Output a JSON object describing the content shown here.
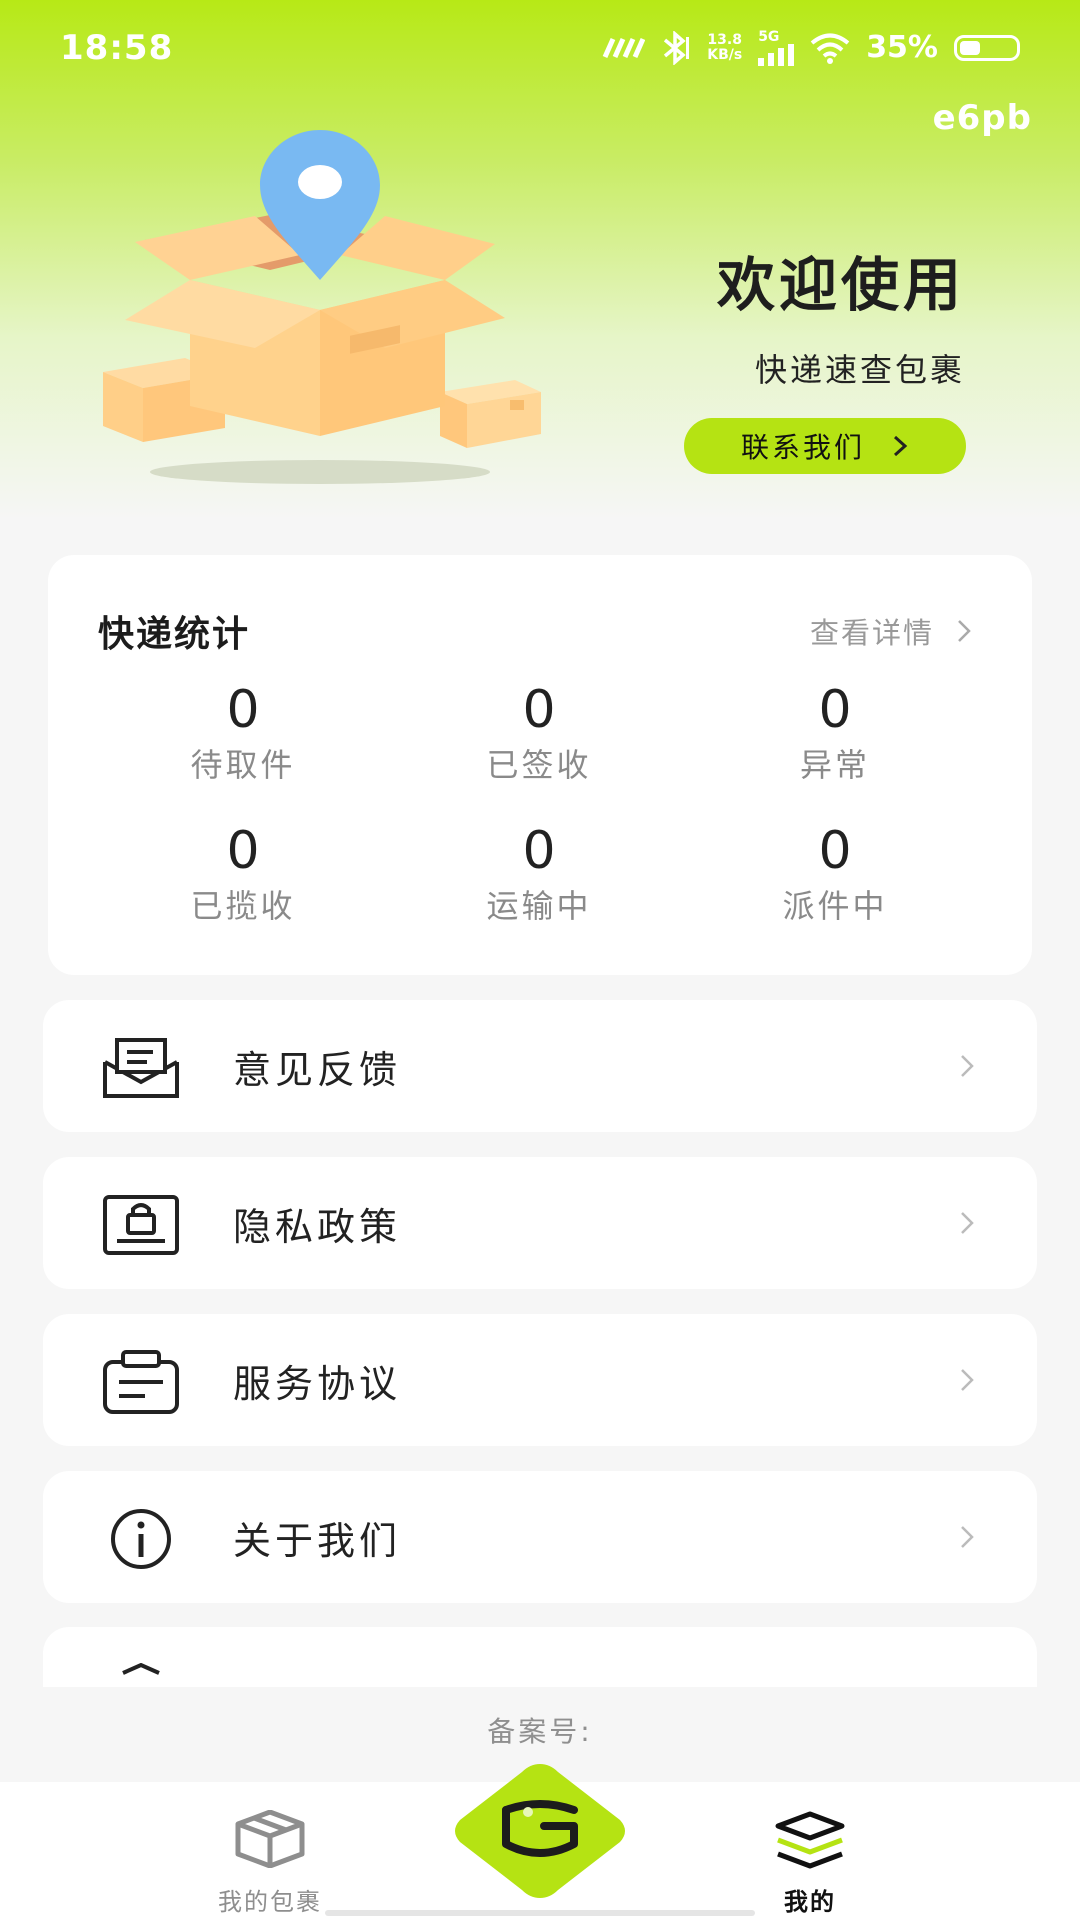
{
  "status_bar": {
    "time": "18:58",
    "network_speed_value": "13.8",
    "network_speed_unit": "KB/s",
    "signal_label": "5G",
    "battery": "35%"
  },
  "header": {
    "code_tag": "e6pb",
    "welcome_title": "欢迎使用",
    "welcome_subtitle": "快递速查包裹",
    "contact_button": "联系我们"
  },
  "stats": {
    "title": "快递统计",
    "detail_link": "查看详情",
    "items": [
      {
        "value": "0",
        "label": "待取件"
      },
      {
        "value": "0",
        "label": "已签收"
      },
      {
        "value": "0",
        "label": "异常"
      },
      {
        "value": "0",
        "label": "已揽收"
      },
      {
        "value": "0",
        "label": "运输中"
      },
      {
        "value": "0",
        "label": "派件中"
      }
    ]
  },
  "menu": {
    "items": [
      {
        "label": "意见反馈",
        "icon": "envelope-icon"
      },
      {
        "label": "隐私政策",
        "icon": "privacy-lock-icon"
      },
      {
        "label": "服务协议",
        "icon": "clipboard-icon"
      },
      {
        "label": "关于我们",
        "icon": "info-icon"
      }
    ]
  },
  "footer": {
    "record_label": "备案号:"
  },
  "bottom_nav": {
    "items": [
      {
        "label": "我的包裹",
        "icon": "package-icon"
      },
      {
        "label": "",
        "icon": "scan-logo-icon"
      },
      {
        "label": "我的",
        "icon": "layers-icon"
      }
    ]
  },
  "colors": {
    "accent": "#b5e313",
    "hero_top": "#b7e916",
    "background": "#f6f6f6"
  }
}
